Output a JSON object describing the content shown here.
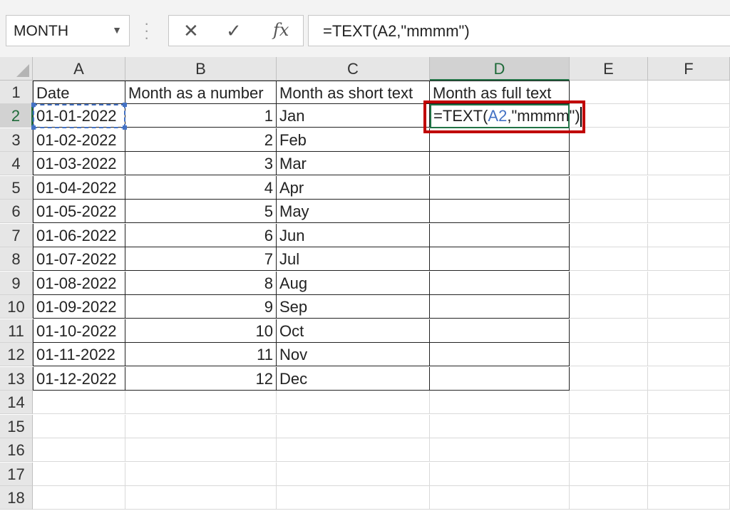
{
  "formula_bar": {
    "name_box": "MONTH",
    "cancel_icon": "x-icon",
    "enter_icon": "check-icon",
    "fx_label": "fx",
    "formula": "=TEXT(A2,\"mmmm\")"
  },
  "columns": [
    "A",
    "B",
    "C",
    "D",
    "E",
    "F"
  ],
  "rows": [
    "1",
    "2",
    "3",
    "4",
    "5",
    "6",
    "7",
    "8",
    "9",
    "10",
    "11",
    "12",
    "13",
    "14",
    "15",
    "16",
    "17",
    "18"
  ],
  "headers": {
    "a": "Date",
    "b": "Month as a number",
    "c": "Month as short text",
    "d": "Month as full text"
  },
  "editing_cell": {
    "prefix": "=TEXT(",
    "ref": "A2",
    "suffix": ",\"mmmm\")"
  },
  "table": [
    {
      "date": "01-01-2022",
      "num": "1",
      "short": "Jan"
    },
    {
      "date": "01-02-2022",
      "num": "2",
      "short": "Feb"
    },
    {
      "date": "01-03-2022",
      "num": "3",
      "short": "Mar"
    },
    {
      "date": "01-04-2022",
      "num": "4",
      "short": "Apr"
    },
    {
      "date": "01-05-2022",
      "num": "5",
      "short": "May"
    },
    {
      "date": "01-06-2022",
      "num": "6",
      "short": "Jun"
    },
    {
      "date": "01-07-2022",
      "num": "7",
      "short": "Jul"
    },
    {
      "date": "01-08-2022",
      "num": "8",
      "short": "Aug"
    },
    {
      "date": "01-09-2022",
      "num": "9",
      "short": "Sep"
    },
    {
      "date": "01-10-2022",
      "num": "10",
      "short": "Oct"
    },
    {
      "date": "01-11-2022",
      "num": "11",
      "short": "Nov"
    },
    {
      "date": "01-12-2022",
      "num": "12",
      "short": "Dec"
    }
  ],
  "colors": {
    "selected_header": "#217346",
    "reference_blue": "#4472c4",
    "highlight_red": "#c00000"
  }
}
